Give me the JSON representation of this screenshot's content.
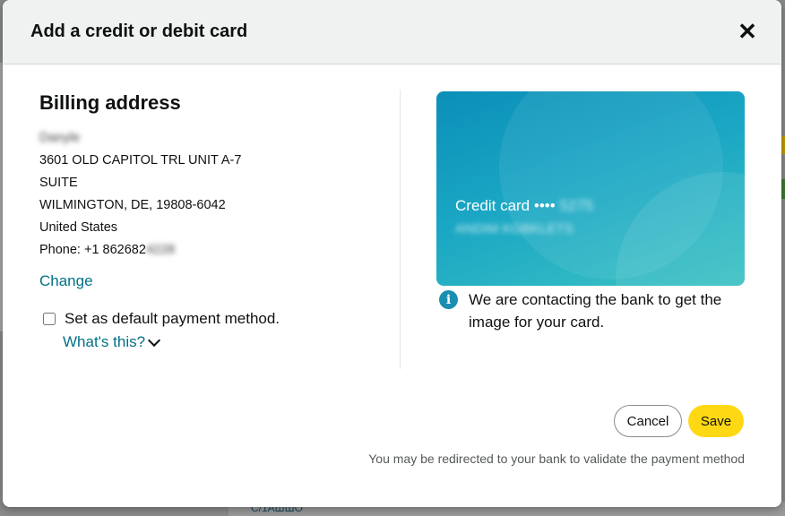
{
  "modal": {
    "title": "Add a credit or debit card",
    "close_symbol": "✕"
  },
  "billing": {
    "title": "Billing address",
    "name": "Danyle",
    "lines": [
      "3601 OLD CAPITOL TRL UNIT A-7",
      "SUITE",
      "WILMINGTON, DE, 19808-6042",
      "United States"
    ],
    "phone_label": "Phone: +1 862682",
    "phone_hidden": "4228",
    "change_label": "Change",
    "default_label": "Set as default payment method.",
    "whats_this_label": "What's this?"
  },
  "card": {
    "type_label": "Credit card",
    "dots": "••••",
    "last4": "5275",
    "name": "ANDIM KGBKLETS"
  },
  "info": {
    "icon": "i",
    "text": "We are contacting the bank to get the image for your card."
  },
  "actions": {
    "cancel_label": "Cancel",
    "save_label": "Save",
    "note": "You may be redirected to your bank to validate the payment method"
  },
  "background": {
    "bottom_text": "C/1АШШО"
  },
  "colors": {
    "link": "#007185",
    "save_button": "#ffd814",
    "header_bg": "#f0f2f2",
    "card_gradient_start": "#0b8fb8",
    "card_gradient_end": "#3cc2c3"
  }
}
